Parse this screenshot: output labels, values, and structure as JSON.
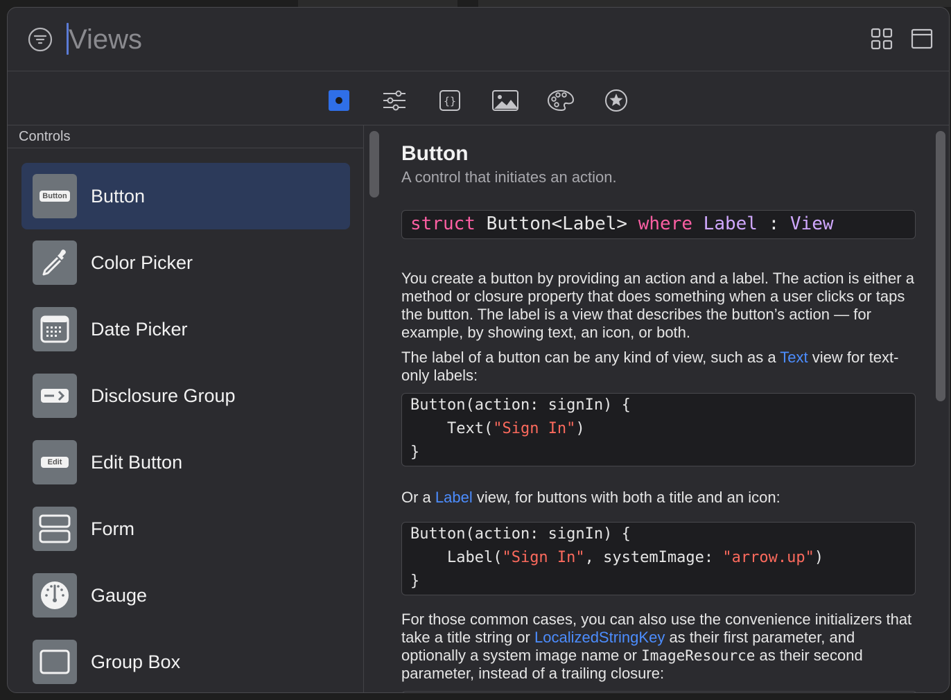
{
  "search": {
    "placeholder": "Views"
  },
  "tabs": [
    {
      "icon": "view-square-icon",
      "selected": true
    },
    {
      "icon": "sliders-icon"
    },
    {
      "icon": "curly-braces-icon"
    },
    {
      "icon": "photo-icon"
    },
    {
      "icon": "palette-icon"
    },
    {
      "icon": "star-circle-icon"
    }
  ],
  "sidebar": {
    "section": "Controls",
    "items": [
      {
        "label": "Button",
        "icon": "button-icon",
        "icon_text": "Button",
        "selected": true
      },
      {
        "label": "Color Picker",
        "icon": "eyedropper-icon"
      },
      {
        "label": "Date Picker",
        "icon": "calendar-icon"
      },
      {
        "label": "Disclosure Group",
        "icon": "disclosure-icon"
      },
      {
        "label": "Edit Button",
        "icon": "edit-button-icon",
        "icon_text": "Edit"
      },
      {
        "label": "Form",
        "icon": "form-icon"
      },
      {
        "label": "Gauge",
        "icon": "gauge-icon"
      },
      {
        "label": "Group Box",
        "icon": "group-box-icon"
      }
    ]
  },
  "detail": {
    "title": "Button",
    "subtitle": "A control that initiates an action.",
    "declaration": {
      "kw1": "struct",
      "name": " Button<Label> ",
      "kw2": "where",
      "t1": " Label",
      "colon": " : ",
      "t2": "View"
    },
    "p1": "You create a button by providing an action and a label. The action is either a method or closure property that does something when a user clicks or taps the button. The label is a view that describes the button’s action — for example, by showing text, an icon, or both.",
    "p2_pre": "The label of a button can be any kind of view, such as a ",
    "p2_link": "Text",
    "p2_post": " view for text-only labels:",
    "code1": {
      "l1": "Button(action: signIn) {",
      "l2_pre": "    Text(",
      "l2_str": "\"Sign In\"",
      "l2_post": ")",
      "l3": "}"
    },
    "p3_pre": "Or a ",
    "p3_link": "Label",
    "p3_post": " view, for buttons with both a title and an icon:",
    "code2": {
      "l1": "Button(action: signIn) {",
      "l2_pre": "    Label(",
      "l2_str1": "\"Sign In\"",
      "l2_mid": ", systemImage: ",
      "l2_str2": "\"arrow.up\"",
      "l2_post": ")",
      "l3": "}"
    },
    "p4_pre": "For those common cases, you can also use the convenience initializers that take a title string or ",
    "p4_link": "LocalizedStringKey",
    "p4_mid": " as their first parameter, and optionally a system image name or ",
    "p4_code": "ImageResource",
    "p4_post": " as their second parameter, instead of a trailing closure:"
  },
  "colors": {
    "accent": "#2f6fe8",
    "link": "#4c8dff",
    "keyword": "#fc5fa3",
    "type": "#d0a8ff",
    "string": "#fc6a5d",
    "selection": "#2c3a5a"
  }
}
